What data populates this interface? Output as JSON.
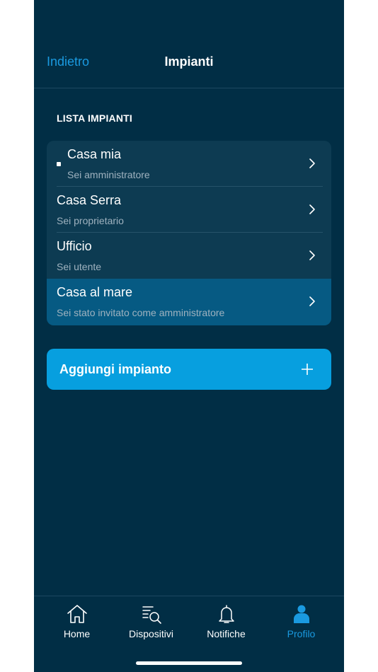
{
  "header": {
    "back_label": "Indietro",
    "title": "Impianti"
  },
  "section": {
    "title": "LISTA IMPIANTI"
  },
  "plants": [
    {
      "name": "Casa mia",
      "role": "Sei amministratore",
      "selected": true
    },
    {
      "name": "Casa Serra",
      "role": "Sei proprietario",
      "selected": false
    },
    {
      "name": "Ufficio",
      "role": "Sei utente",
      "selected": false
    },
    {
      "name": "Casa al mare",
      "role": "Sei stato invitato come amministratore",
      "selected": false,
      "highlighted": true
    }
  ],
  "add_button": {
    "label": "Aggiungi impianto",
    "icon": "plus-icon"
  },
  "tabbar": {
    "items": [
      {
        "label": "Home",
        "icon": "house-icon",
        "active": false
      },
      {
        "label": "Dispositivi",
        "icon": "device-search-icon",
        "active": false
      },
      {
        "label": "Notifiche",
        "icon": "bell-icon",
        "active": false
      },
      {
        "label": "Profilo",
        "icon": "person-icon",
        "active": true
      }
    ]
  },
  "colors": {
    "background": "#012e45",
    "list_background": "#0d3b52",
    "highlight": "#065a83",
    "accent": "#079fdf",
    "link": "#1a9ae0",
    "secondary_text": "#9fb2bf"
  }
}
